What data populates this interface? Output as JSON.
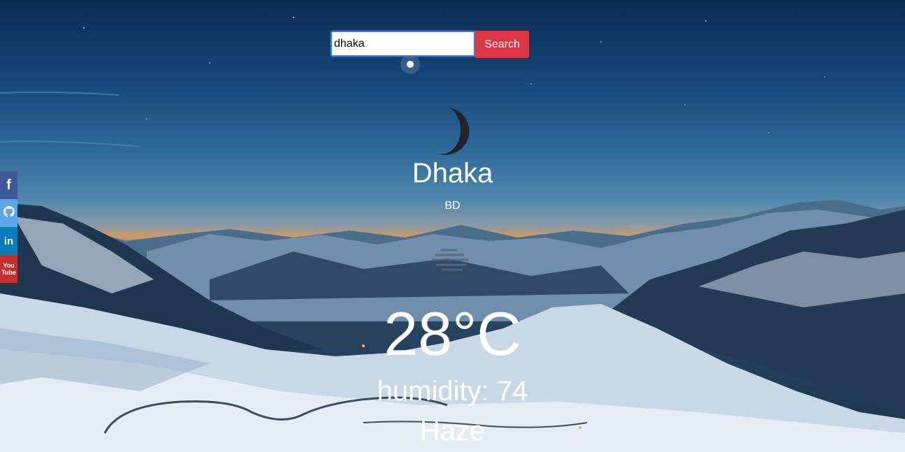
{
  "search": {
    "value": "dhaka",
    "button_label": "Search"
  },
  "weather": {
    "icon": "moon-icon",
    "city": "Dhaka",
    "country": "BD",
    "condition_icon": "haze-icon",
    "temperature": "28°C",
    "humidity": "humidity: 74",
    "description": "Haze"
  },
  "social": [
    {
      "name": "facebook",
      "label": "f",
      "color": "#3b5998"
    },
    {
      "name": "github",
      "label": "",
      "color": "#5aa6e6"
    },
    {
      "name": "linkedin",
      "label": "in",
      "color": "#0a7ab8"
    },
    {
      "name": "youtube",
      "label_top": "You",
      "label_bottom": "Tube",
      "color": "#c4302b"
    }
  ],
  "colors": {
    "search_button": "#dc3545",
    "input_border": "#3b7dd8",
    "text": "#ffffff"
  }
}
